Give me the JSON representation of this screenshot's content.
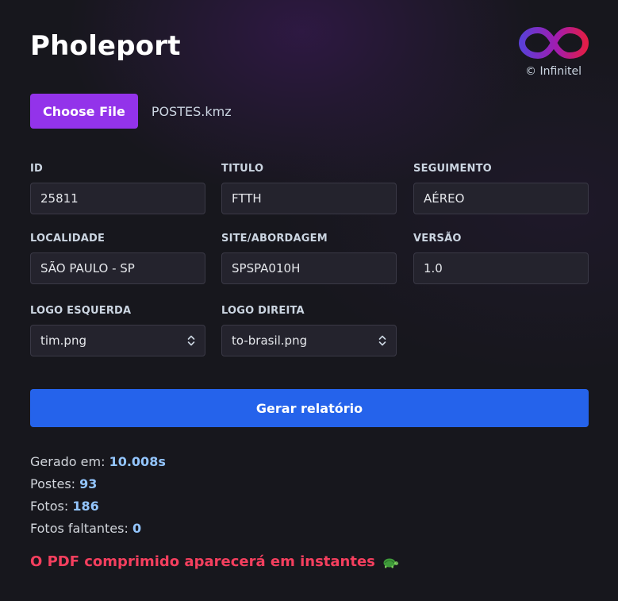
{
  "app": {
    "title": "Pholeport"
  },
  "brand": {
    "copyright": "© Infinitel"
  },
  "upload": {
    "button_label": "Choose File",
    "file_name": "POSTES.kmz"
  },
  "fields": {
    "id": {
      "label": "ID",
      "value": "25811"
    },
    "titulo": {
      "label": "TITULO",
      "value": "FTTH"
    },
    "seguimento": {
      "label": "SEGUIMENTO",
      "value": "AÉREO"
    },
    "localidade": {
      "label": "LOCALIDADE",
      "value": "SÃO PAULO - SP"
    },
    "site": {
      "label": "SITE/ABORDAGEM",
      "value": "SPSPA010H"
    },
    "versao": {
      "label": "VERSÃO",
      "value": "1.0"
    },
    "logo_esquerda": {
      "label": "LOGO ESQUERDA",
      "value": "tim.png"
    },
    "logo_direita": {
      "label": "LOGO DIREITA",
      "value": "to-brasil.png"
    }
  },
  "actions": {
    "generate_label": "Gerar relatório"
  },
  "stats": {
    "generated_label": "Gerado em:",
    "generated_value": "10.008s",
    "postes_label": "Postes:",
    "postes_value": "93",
    "fotos_label": "Fotos:",
    "fotos_value": "186",
    "faltantes_label": "Fotos faltantes:",
    "faltantes_value": "0"
  },
  "notice": {
    "text": "O PDF comprimido aparecerá em instantes",
    "icon": "turtle-icon"
  },
  "colors": {
    "background": "#17171d",
    "choose_button": "#9333ea",
    "generate_button": "#2563eb",
    "stat_value": "#93c5fd",
    "notice": "#f43f5e"
  }
}
